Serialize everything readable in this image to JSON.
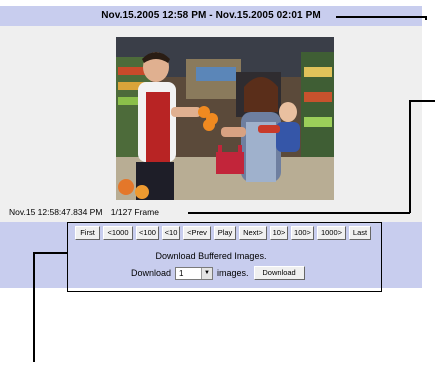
{
  "header": {
    "time_range": "Nov.15.2005 12:58 PM - Nov.15.2005 02:01 PM"
  },
  "viewer": {
    "image_description_icon": "camera-still-icon",
    "timestamp": "Nov.15 12:58:47.834 PM",
    "frame": "1/127 Frame"
  },
  "navigation": {
    "buttons": [
      "First",
      "<1000",
      "<100",
      "<10",
      "<Prev",
      "Play",
      "Next>",
      "10>",
      "100>",
      "1000>",
      "Last"
    ]
  },
  "download": {
    "title": "Download Buffered Images.",
    "label": "Download",
    "selected_count": "1",
    "unit": "images.",
    "button": "Download"
  },
  "colors": {
    "panel": "#c8cdee",
    "content_bg": "#efefef"
  }
}
